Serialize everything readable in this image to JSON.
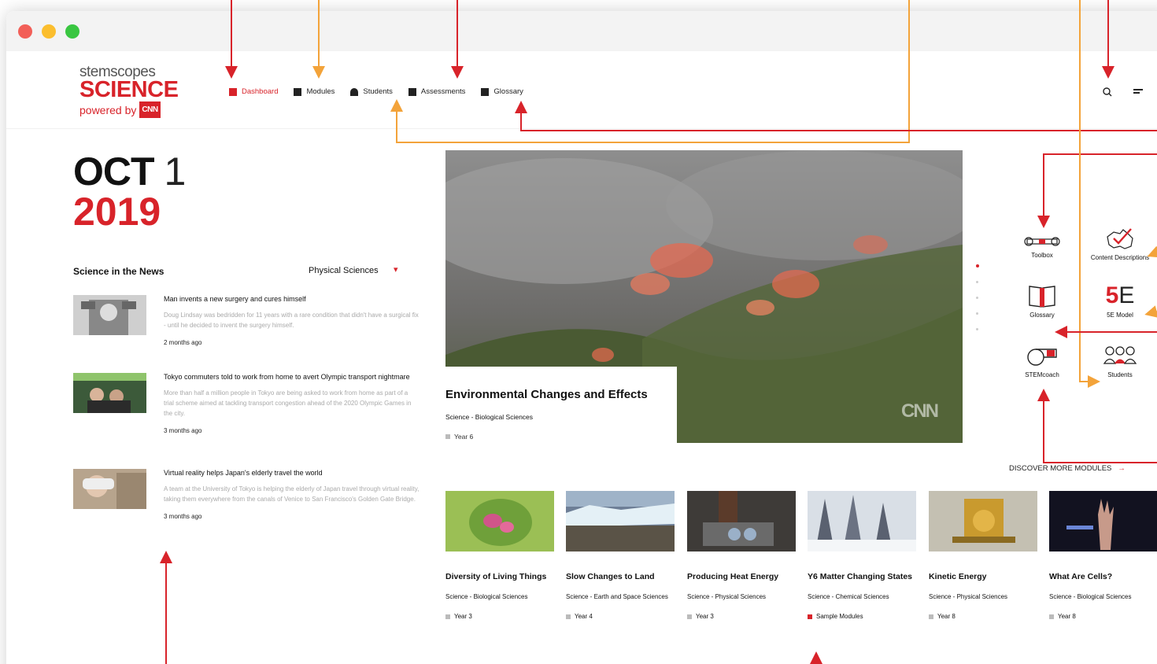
{
  "header": {
    "logo": {
      "line1": "stemscopes",
      "line2": "SCIENCE",
      "line3": "powered by",
      "badge": "CNN"
    },
    "nav": [
      {
        "label": "Dashboard",
        "icon": "dashboard-icon",
        "active": true
      },
      {
        "label": "Modules",
        "icon": "modules-icon"
      },
      {
        "label": "Students",
        "icon": "students-icon"
      },
      {
        "label": "Assessments",
        "icon": "assessments-icon"
      },
      {
        "label": "Glossary",
        "icon": "glossary-icon"
      }
    ],
    "search_icon": "search-icon",
    "menu_icon": "menu-icon"
  },
  "date": {
    "month": "OCT",
    "day": "1",
    "year": "2019"
  },
  "news": {
    "heading": "Science in the News",
    "filter": "Physical Sciences",
    "items": [
      {
        "title": "Man invents a new surgery and cures himself",
        "desc": "Doug Lindsay was bedridden for 11 years with a rare condition that didn't have a surgical fix - until he decided to invent the surgery himself.",
        "time": "2 months ago"
      },
      {
        "title": "Tokyo commuters told to work from home to avert Olympic transport nightmare",
        "desc": "More than half a million people in Tokyo are being asked to work from home as part of a trial scheme aimed at tackling transport congestion ahead of the 2020 Olympic Games in the city.",
        "time": "3 months ago"
      },
      {
        "title": "Virtual reality helps Japan's elderly travel the world",
        "desc": "A team at the University of Tokyo is helping the elderly of Japan travel through virtual reality, taking them everywhere from the canals of Venice to San Francisco's Golden Gate Bridge.",
        "time": "3 months ago"
      }
    ]
  },
  "hero": {
    "title": "Environmental Changes and Effects",
    "subject": "Science - Biological Sciences",
    "year": "Year 6",
    "watermark": "CNN"
  },
  "tools": [
    {
      "label": "Toolbox",
      "icon": "toolbox-icon"
    },
    {
      "label": "Content Descriptions",
      "icon": "australia-map-icon"
    },
    {
      "label": "Glossary",
      "icon": "book-icon"
    },
    {
      "label": "5E Model",
      "icon": "5e-icon",
      "glyph": "5",
      "glyph2": "E"
    },
    {
      "label": "STEMcoach",
      "icon": "whistle-icon"
    },
    {
      "label": "Students",
      "icon": "group-icon"
    }
  ],
  "discover": {
    "label": "DISCOVER MORE MODULES",
    "arrow": "→"
  },
  "modules": [
    {
      "title": "Diversity of Living Things",
      "subject": "Science - Biological Sciences",
      "tag": "Year 3"
    },
    {
      "title": "Slow Changes to Land",
      "subject": "Science - Earth and Space Sciences",
      "tag": "Year 4"
    },
    {
      "title": "Producing Heat Energy",
      "subject": "Science - Physical Sciences",
      "tag": "Year 3"
    },
    {
      "title": "Y6 Matter Changing States",
      "subject": "Science - Chemical Sciences",
      "tag": "Sample Modules"
    },
    {
      "title": "Kinetic Energy",
      "subject": "Science - Physical Sciences",
      "tag": "Year 8"
    },
    {
      "title": "What Are Cells?",
      "subject": "Science - Biological Sciences",
      "tag": "Year 8"
    }
  ],
  "colors": {
    "accent": "#d8232a",
    "annotation_red": "#d8232a",
    "annotation_orange": "#f3a33a"
  }
}
